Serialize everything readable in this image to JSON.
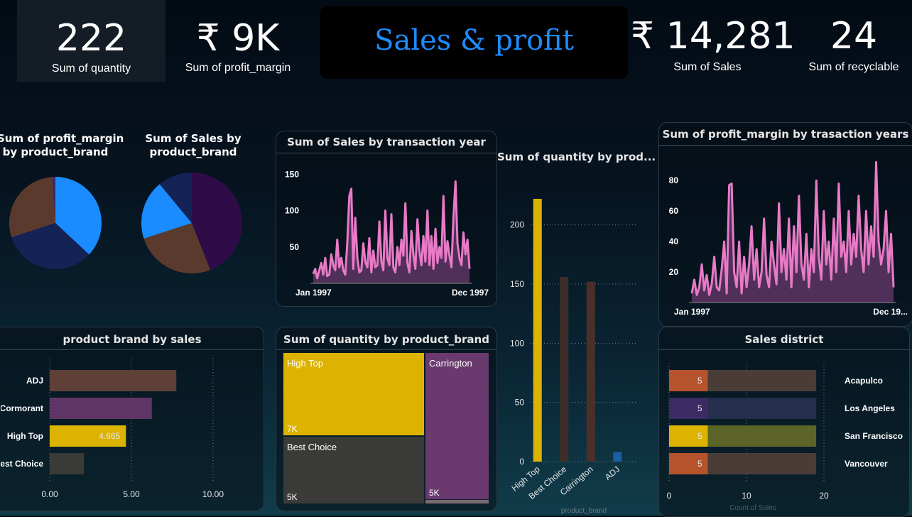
{
  "colors": {
    "ADJ": "#5e4036",
    "Cormorant": "#5f3766",
    "High Top": "#dcb300",
    "Best Choice": "#3a3a38",
    "Carrington": "#6a3a6e",
    "pie_blue": "#1a8cff",
    "pie_navy": "#152255",
    "pie_brown": "#5b3a2e",
    "pie_purple": "#2f0b47",
    "line_pink": "#e87ac6"
  },
  "kpis": {
    "quantity": {
      "value": "222",
      "label": "Sum of quantity"
    },
    "profit_margin": {
      "value": "₹ 9K",
      "label": "Sum of profit_margin"
    },
    "sales": {
      "value": "₹ 14,281",
      "label": "Sum of Sales"
    },
    "recyclable": {
      "value": "24",
      "label": "Sum of recyclable"
    }
  },
  "header_title": "Sales & profit",
  "pie1": {
    "title_line1": "Sum of profit_margin",
    "title_line2": "by product_brand",
    "chart_data": {
      "type": "pie",
      "slices": [
        {
          "color": "#1a8cff",
          "value": 37
        },
        {
          "color": "#152255",
          "value": 33
        },
        {
          "color": "#5b3a2e",
          "value": 29
        },
        {
          "color": "#3a2a6a",
          "value": 1
        }
      ]
    }
  },
  "pie2": {
    "title_line1": "Sum of Sales by",
    "title_line2": "product_brand",
    "chart_data": {
      "type": "pie",
      "slices": [
        {
          "color": "#2f0b47",
          "value": 44
        },
        {
          "color": "#5b3a2e",
          "value": 26
        },
        {
          "color": "#1a8cff",
          "value": 19
        },
        {
          "color": "#152255",
          "value": 11
        }
      ]
    }
  },
  "sales_by_year": {
    "title": "Sum of Sales by transaction year",
    "chart_data": {
      "type": "area",
      "x_start": "Jan 1997",
      "x_end": "Dec 1997",
      "ylim": [
        0,
        160
      ],
      "yticks": [
        50,
        100,
        150
      ],
      "values": [
        13,
        20,
        7,
        18,
        28,
        12,
        35,
        10,
        12,
        40,
        25,
        18,
        60,
        22,
        35,
        18,
        12,
        55,
        120,
        130,
        20,
        90,
        35,
        15,
        18,
        55,
        30,
        22,
        62,
        15,
        45,
        22,
        25,
        85,
        30,
        18,
        100,
        35,
        25,
        95,
        22,
        15,
        50,
        25,
        60,
        38,
        110,
        28,
        15,
        72,
        40,
        20,
        88,
        45,
        25,
        65,
        30,
        100,
        25,
        65,
        20,
        75,
        28,
        50,
        35,
        120,
        30,
        58,
        38,
        22,
        90,
        140,
        55,
        35,
        25,
        70,
        40,
        60,
        20
      ]
    }
  },
  "profit_by_year": {
    "title": "Sum of profit_margin by trasaction years",
    "chart_data": {
      "type": "area",
      "x_start": "Jan 1997",
      "x_end": "Dec 19...",
      "ylim": [
        0,
        95
      ],
      "yticks": [
        20,
        40,
        60,
        80
      ],
      "values": [
        6,
        15,
        5,
        10,
        25,
        8,
        18,
        5,
        12,
        30,
        10,
        8,
        22,
        40,
        6,
        77,
        78,
        20,
        10,
        40,
        6,
        30,
        10,
        25,
        50,
        15,
        35,
        10,
        20,
        55,
        18,
        10,
        40,
        25,
        12,
        65,
        20,
        35,
        15,
        55,
        10,
        50,
        20,
        70,
        25,
        15,
        45,
        10,
        35,
        20,
        80,
        30,
        15,
        60,
        25,
        40,
        15,
        55,
        20,
        78,
        30,
        40,
        20,
        60,
        25,
        45,
        30,
        70,
        35,
        20,
        60,
        25,
        50,
        30,
        92,
        40,
        25,
        35,
        60,
        20,
        45,
        10
      ]
    }
  },
  "qty_by_product": {
    "title": "Sum of quantity by prod...",
    "axis_label": "product_brand",
    "chart_data": {
      "type": "bar",
      "categories": [
        "High Top",
        "Best Choice",
        "Carrington",
        "ADJ"
      ],
      "values": [
        222,
        156,
        152,
        8
      ],
      "colors": [
        "#dcb300",
        "#3e2e2a",
        "#4a3028",
        "#1a5fa0"
      ],
      "ylim": [
        0,
        240
      ],
      "yticks": [
        0,
        50,
        100,
        150,
        200
      ]
    }
  },
  "brand_by_sales": {
    "title": "product brand by sales",
    "chart_data": {
      "type": "bar",
      "categories": [
        "ADJ",
        "Cormorant",
        "High Top",
        "Best Choice"
      ],
      "values": [
        7.75,
        6.25,
        4.665,
        2.1
      ],
      "colors": [
        "#5e4036",
        "#5f3766",
        "#dcb300",
        "#3a3a38"
      ],
      "data_label": "4.665",
      "xlim": [
        0,
        11
      ],
      "xticks": [
        "0.00",
        "5.00",
        "10.00"
      ]
    }
  },
  "treemap": {
    "title": "Sum of quantity by product_brand",
    "tiles": [
      {
        "name": "High Top",
        "value": "7K",
        "color": "#dcb300"
      },
      {
        "name": "Carrington",
        "value": "5K",
        "color": "#6a3a6e"
      },
      {
        "name": "Best Choice",
        "value": "5K",
        "color": "#3a3a38"
      }
    ]
  },
  "sales_district": {
    "title": "Sales district",
    "axis_label": "Count of Sales",
    "xticks": [
      "0",
      "10",
      "20"
    ],
    "chart_data": {
      "type": "bar",
      "rows": [
        {
          "district": "Acapulco",
          "value": 5,
          "total": 19,
          "color": "#b5532c",
          "track": "#4a3d38"
        },
        {
          "district": "Los Angeles",
          "value": 5,
          "total": 19,
          "color": "#3b2a63",
          "track": "#252e4d"
        },
        {
          "district": "San Francisco",
          "value": 5,
          "total": 19,
          "color": "#dcb300",
          "track": "#5c6428"
        },
        {
          "district": "Vancouver",
          "value": 5,
          "total": 19,
          "color": "#b5532c",
          "track": "#4a3d38"
        }
      ]
    }
  }
}
